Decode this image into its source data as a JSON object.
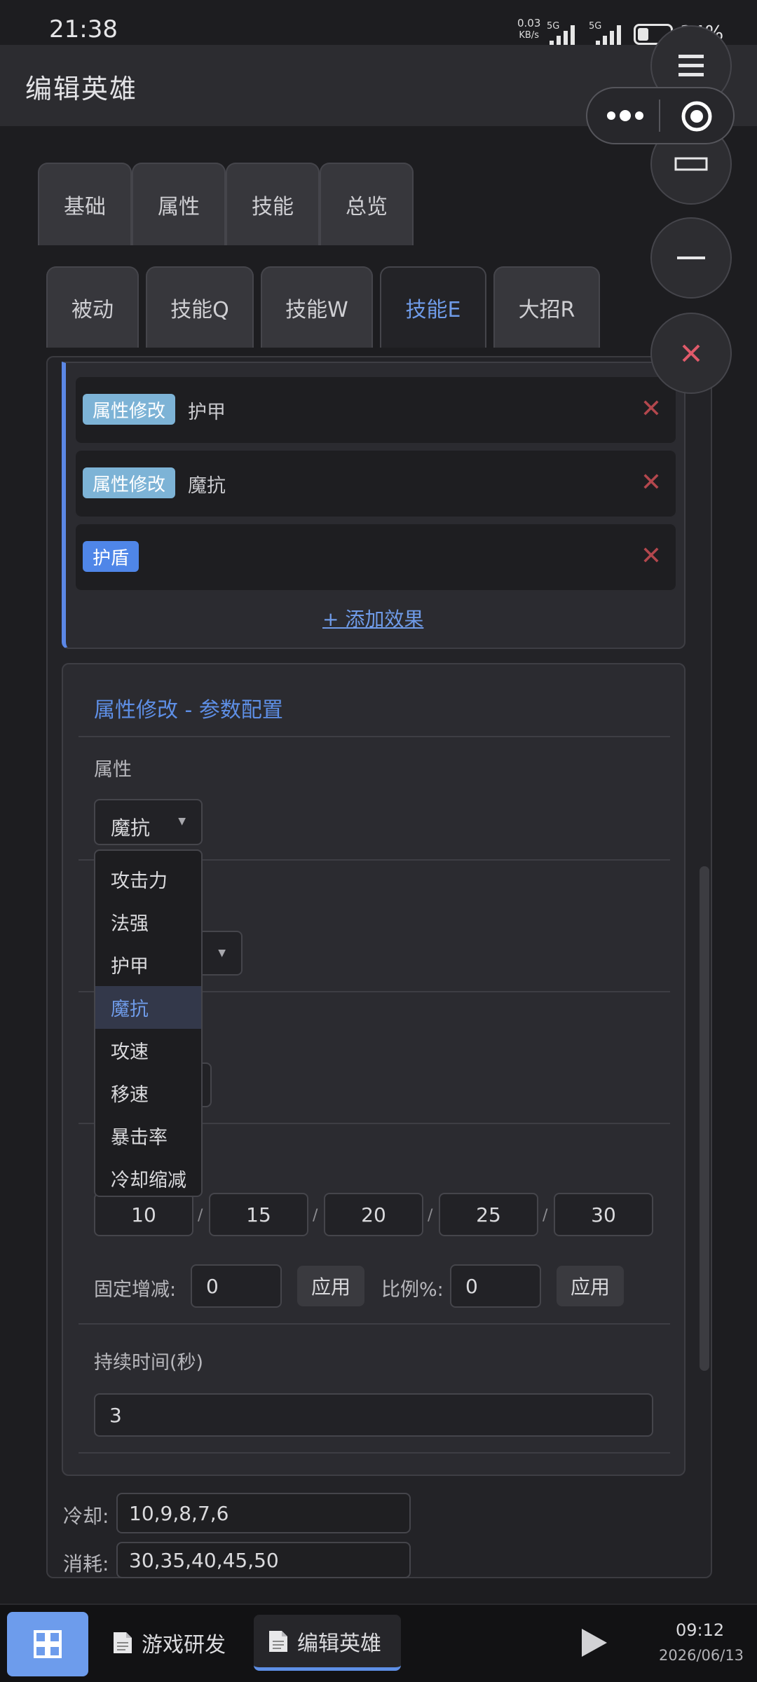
{
  "status_bar": {
    "time": "21:38",
    "net_speed_value": "0.03",
    "net_speed_unit": "KB/s",
    "signal_label_1": "5G",
    "signal_label_2": "5G",
    "battery_percent": "34%",
    "battery_level": 0.34
  },
  "header": {
    "title": "编辑英雄"
  },
  "main_tabs": [
    {
      "label": "基础",
      "active": false
    },
    {
      "label": "属性",
      "active": false
    },
    {
      "label": "技能",
      "active": false
    },
    {
      "label": "总览",
      "active": false
    }
  ],
  "skill_tabs": [
    {
      "label": "被动",
      "active": false
    },
    {
      "label": "技能Q",
      "active": false
    },
    {
      "label": "技能W",
      "active": false
    },
    {
      "label": "技能E",
      "active": true
    },
    {
      "label": "大招R",
      "active": false
    }
  ],
  "effects": [
    {
      "tag": "属性修改",
      "name": "护甲"
    },
    {
      "tag": "属性修改",
      "name": "魔抗"
    },
    {
      "tag": "护盾",
      "name": ""
    }
  ],
  "remove_symbol": "✕",
  "add_effect_label": "+ 添加效果",
  "params": {
    "title": "属性修改 - 参数配置",
    "attribute_label": "属性",
    "attribute_selected": "魔抗",
    "dropdown_options": [
      "攻击力",
      "法强",
      "护甲",
      "魔抗",
      "攻速",
      "移速",
      "暴击率",
      "冷却缩减"
    ],
    "dropdown_selected_index": 3,
    "level_values": [
      "10",
      "15",
      "20",
      "25",
      "30"
    ],
    "level_separator": "/",
    "fixed_label": "固定增减:",
    "fixed_value": "0",
    "apply_label": "应用",
    "ratio_label": "比例%:",
    "ratio_value": "0",
    "duration_label": "持续时间(秒)",
    "duration_value": "3"
  },
  "skill_fields": {
    "cooldown_label": "冷却:",
    "cooldown_value": "10,9,8,7,6",
    "cost_label": "消耗:",
    "cost_value": "30,35,40,45,50"
  },
  "floating": {
    "menu_icon": "hamburger-menu-icon",
    "maximize_icon": "maximize-icon",
    "minimize_icon": "minimize-icon",
    "close_icon": "close-icon",
    "more_icon": "more-dots-icon",
    "target_icon": "target-icon"
  },
  "taskbar": {
    "tasks": [
      {
        "label": "游戏研发",
        "active": false
      },
      {
        "label": "编辑英雄",
        "active": true
      }
    ],
    "time": "09:12",
    "date": "2026/06/13"
  },
  "colors": {
    "accent": "#5e8fe6",
    "attr_tag": "#7db3d6",
    "shield_tag": "#4f86e8",
    "remove": "#b3474d"
  }
}
